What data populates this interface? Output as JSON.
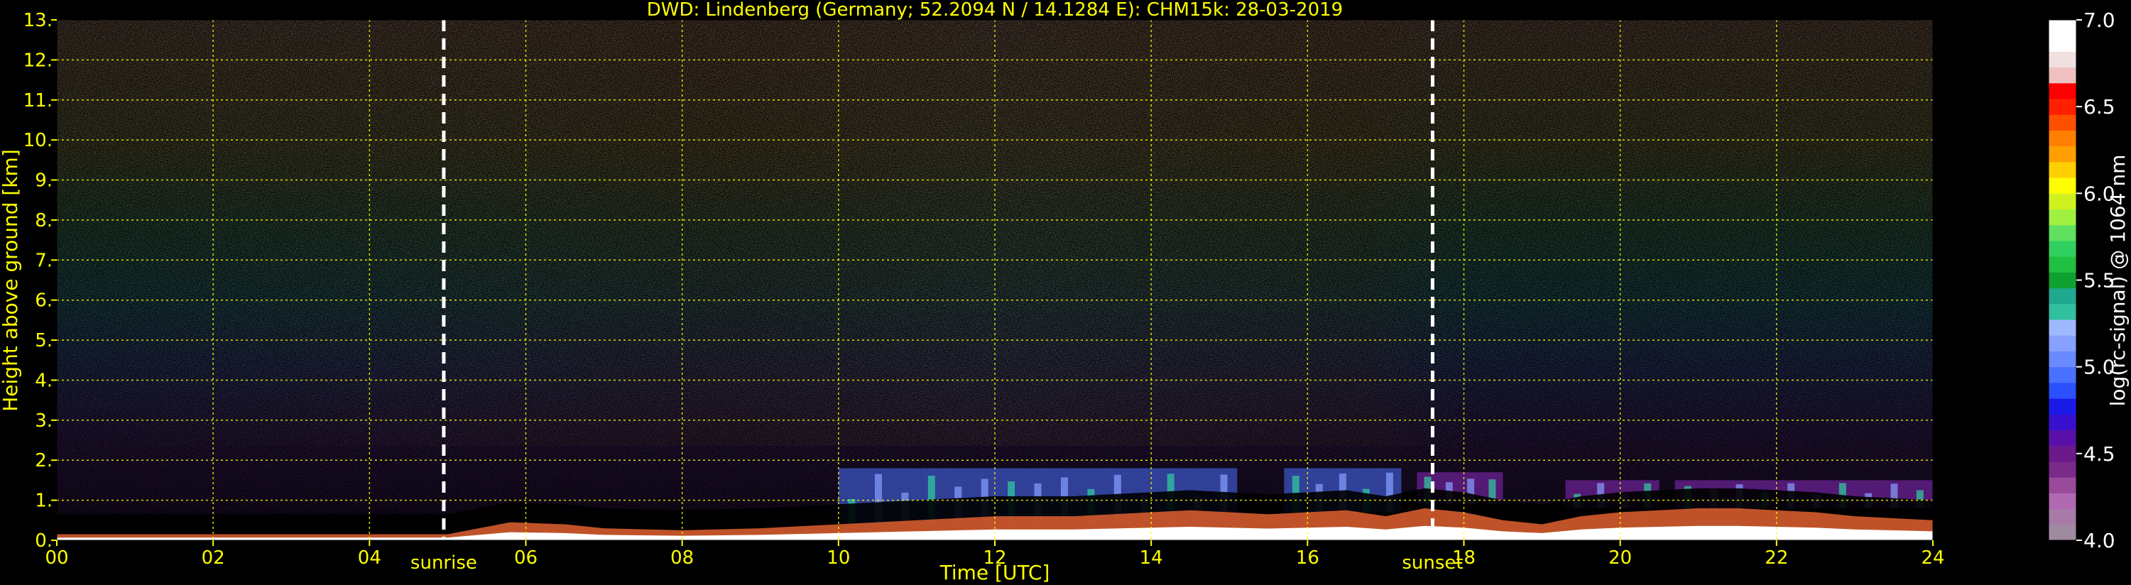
{
  "chart_data": {
    "type": "heatmap",
    "title": "DWD: Lindenberg (Germany; 52.2094 N / 14.1284 E):    CHM15k: 28-03-2019",
    "xlabel": "Time [UTC]",
    "ylabel": "Height above ground [km]",
    "xlim": [
      0,
      24
    ],
    "ylim": [
      0,
      13
    ],
    "x_ticks": [
      0,
      2,
      4,
      6,
      8,
      10,
      12,
      14,
      16,
      18,
      20,
      22,
      24
    ],
    "x_tick_labels": [
      "00",
      "02",
      "04",
      "06",
      "08",
      "10",
      "12",
      "14",
      "16",
      "18",
      "20",
      "22",
      "24"
    ],
    "y_ticks": [
      0,
      1,
      2,
      3,
      4,
      5,
      6,
      7,
      8,
      9,
      10,
      11,
      12,
      13
    ],
    "y_tick_labels": [
      "0.",
      "1.",
      "2.",
      "3.",
      "4.",
      "5.",
      "6.",
      "7.",
      "8.",
      "9.",
      "10.",
      "11.",
      "12.",
      "13."
    ],
    "grid": true,
    "colorbar": {
      "label": "log(rc-signal) @ 1064 nm",
      "range": [
        4.0,
        7.0
      ],
      "ticks": [
        4.0,
        4.5,
        5.0,
        5.5,
        6.0,
        6.5,
        7.0
      ],
      "tick_labels": [
        "4.0",
        "4.5",
        "5.0",
        "5.5",
        "6.0",
        "6.5",
        "7.0"
      ],
      "levels": [
        "#a08aa0",
        "#a87aa8",
        "#b068b0",
        "#9a4a9a",
        "#7a2a8a",
        "#6a1a8a",
        "#5a10a8",
        "#3a10d0",
        "#1a1ae8",
        "#2a50ff",
        "#4a70ff",
        "#6a8aff",
        "#88a0ff",
        "#a0b8ff",
        "#30c0a0",
        "#20a890",
        "#10a030",
        "#20c040",
        "#30d060",
        "#60e060",
        "#a0f040",
        "#d0f020",
        "#ffff00",
        "#ffd000",
        "#ffa000",
        "#ff8000",
        "#ff5000",
        "#ff2000",
        "#ff0000",
        "#f0c0c0",
        "#f0e0e0",
        "#ffffff",
        "#ffffff"
      ]
    },
    "annotations": [
      {
        "label": "sunrise",
        "x": 4.95
      },
      {
        "label": "sunset",
        "x": 17.6
      }
    ],
    "boundary_layer_km": [
      [
        0,
        0.15
      ],
      [
        1,
        0.15
      ],
      [
        2,
        0.15
      ],
      [
        3,
        0.15
      ],
      [
        4,
        0.15
      ],
      [
        5,
        0.15
      ],
      [
        5.8,
        0.45
      ],
      [
        6.5,
        0.4
      ],
      [
        7,
        0.3
      ],
      [
        8,
        0.25
      ],
      [
        9,
        0.3
      ],
      [
        9.5,
        0.35
      ],
      [
        10,
        0.4
      ],
      [
        10.5,
        0.45
      ],
      [
        11,
        0.5
      ],
      [
        11.5,
        0.55
      ],
      [
        12,
        0.6
      ],
      [
        12.5,
        0.6
      ],
      [
        13,
        0.6
      ],
      [
        13.5,
        0.65
      ],
      [
        14,
        0.7
      ],
      [
        14.5,
        0.75
      ],
      [
        15,
        0.7
      ],
      [
        15.5,
        0.65
      ],
      [
        16,
        0.7
      ],
      [
        16.5,
        0.75
      ],
      [
        17,
        0.6
      ],
      [
        17.5,
        0.8
      ],
      [
        18,
        0.7
      ],
      [
        18.5,
        0.5
      ],
      [
        19,
        0.4
      ],
      [
        19.5,
        0.6
      ],
      [
        20,
        0.7
      ],
      [
        20.5,
        0.75
      ],
      [
        21,
        0.8
      ],
      [
        21.5,
        0.8
      ],
      [
        22,
        0.75
      ],
      [
        22.5,
        0.7
      ],
      [
        23,
        0.6
      ],
      [
        23.5,
        0.55
      ],
      [
        24,
        0.5
      ]
    ],
    "aerosol_features": [
      {
        "x0": 10.0,
        "x1": 15.1,
        "y0": 0.4,
        "y1": 1.8,
        "level": "blue"
      },
      {
        "x0": 15.7,
        "x1": 17.2,
        "y0": 0.7,
        "y1": 1.8,
        "level": "blue"
      },
      {
        "x0": 17.4,
        "x1": 18.5,
        "y0": 0.9,
        "y1": 1.7,
        "level": "purple"
      },
      {
        "x0": 19.3,
        "x1": 20.5,
        "y0": 0.8,
        "y1": 1.5,
        "level": "purple"
      },
      {
        "x0": 20.7,
        "x1": 24.0,
        "y0": 0.8,
        "y1": 1.5,
        "level": "purple"
      }
    ]
  }
}
